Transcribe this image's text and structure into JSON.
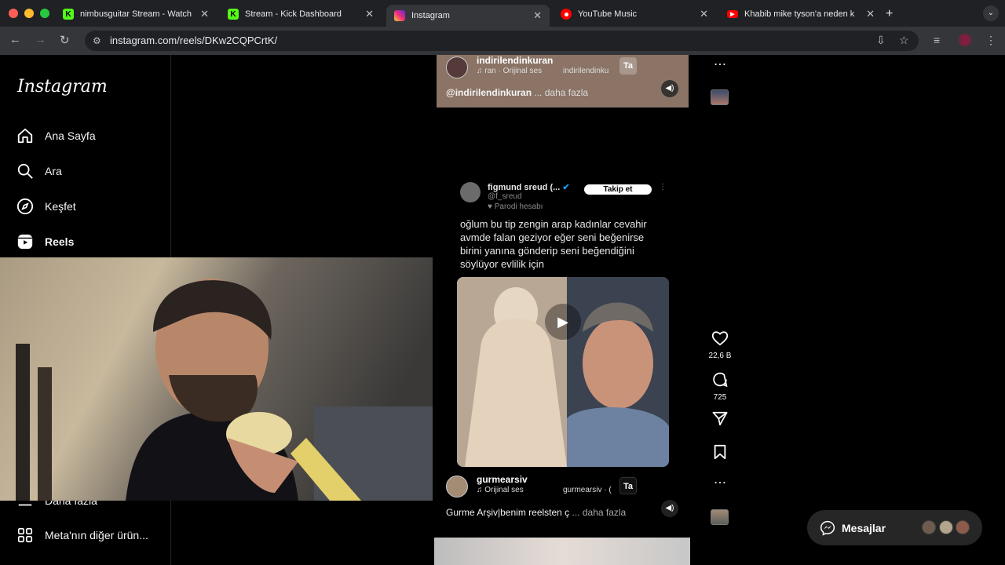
{
  "browser": {
    "tabs": [
      {
        "title": "nimbusguitar Stream - Watch",
        "favicon": "kick-icon",
        "color": "#53fc18"
      },
      {
        "title": "Stream - Kick Dashboard",
        "favicon": "kick-icon",
        "color": "#53fc18"
      },
      {
        "title": "Instagram",
        "favicon": "instagram-icon",
        "color": "#e1306c"
      },
      {
        "title": "YouTube Music",
        "favicon": "youtube-music-icon",
        "color": "#ff0000"
      },
      {
        "title": "Khabib mike tyson'a neden k",
        "favicon": "youtube-icon",
        "color": "#ff0000"
      }
    ],
    "url": "instagram.com/reels/DKw2CQPCrtK/"
  },
  "sidebar": {
    "logo": "Instagram",
    "items": [
      {
        "label": "Ana Sayfa",
        "icon": "home-icon"
      },
      {
        "label": "Ara",
        "icon": "search-icon"
      },
      {
        "label": "Keşfet",
        "icon": "compass-icon"
      },
      {
        "label": "Reels",
        "icon": "reels-icon"
      },
      {
        "label": "Daha fazla",
        "icon": "menu-icon"
      },
      {
        "label": "Meta'nın diğer ürün...",
        "icon": "meta-apps-icon"
      }
    ]
  },
  "reel_top": {
    "username": "indirilendinkuran",
    "audio": "ran · Orijinal ses",
    "audio_user": "indirilendinku",
    "follow_short": "Ta",
    "caption_user": "@indirilendinkuran",
    "caption_more": "... daha fazla"
  },
  "reel_main": {
    "tweet_name": "figmund sreud (...",
    "tweet_handle": "@f_sreud",
    "tweet_badge": "Parodi hesabı",
    "tweet_follow": "Takip et",
    "tweet_text": "oğlum bu tip zengin arap kadınlar cevahir avmde falan geziyor eğer seni beğenirse birini yanına gönderip seni beğendiğini söylüyor evlilik için",
    "username": "gurmearsiv",
    "audio": "Orijinal ses",
    "audio_user": "gurmearsiv · (",
    "follow_short": "Ta",
    "caption": "Gurme Arşiv|benim reelsten ç",
    "caption_more": "... daha fazla"
  },
  "actions": {
    "likes": "22,6 B",
    "comments": "725"
  },
  "messages": {
    "label": "Mesajlar"
  }
}
